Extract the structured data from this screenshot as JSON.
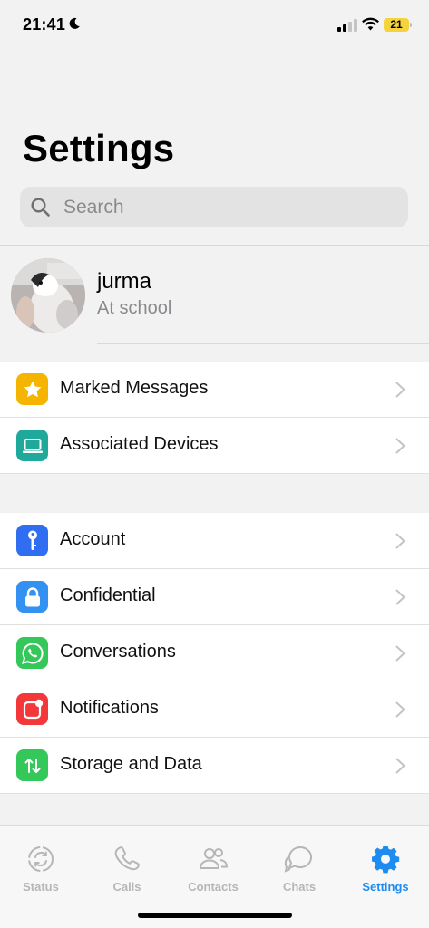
{
  "status_bar": {
    "time": "21:41",
    "battery": "21"
  },
  "header": {
    "title": "Settings"
  },
  "search": {
    "placeholder": "Search"
  },
  "profile": {
    "name": "jurma",
    "status": "At school"
  },
  "group1": [
    {
      "label": "Marked Messages",
      "icon": "star-icon",
      "color": "#f5b400"
    },
    {
      "label": "Associated Devices",
      "icon": "laptop-icon",
      "color": "#1fa99a"
    }
  ],
  "group2": [
    {
      "label": "Account",
      "icon": "key-icon",
      "color": "#2f6ef0"
    },
    {
      "label": "Confidential",
      "icon": "lock-icon",
      "color": "#3391f2"
    },
    {
      "label": "Conversations",
      "icon": "whatsapp-icon",
      "color": "#34c759"
    },
    {
      "label": "Notifications",
      "icon": "notification-icon",
      "color": "#f2383a"
    },
    {
      "label": "Storage and Data",
      "icon": "arrows-updown-icon",
      "color": "#34c759"
    }
  ],
  "tabbar": {
    "items": [
      {
        "label": "Status",
        "icon": "status-icon",
        "active": false
      },
      {
        "label": "Calls",
        "icon": "phone-icon",
        "active": false
      },
      {
        "label": "Contacts",
        "icon": "contacts-icon",
        "active": false
      },
      {
        "label": "Chats",
        "icon": "chat-bubbles-icon",
        "active": false
      },
      {
        "label": "Settings",
        "icon": "gear-icon",
        "active": true
      }
    ],
    "active_color": "#1d8cf0",
    "inactive_color": "#b6b6b6"
  }
}
